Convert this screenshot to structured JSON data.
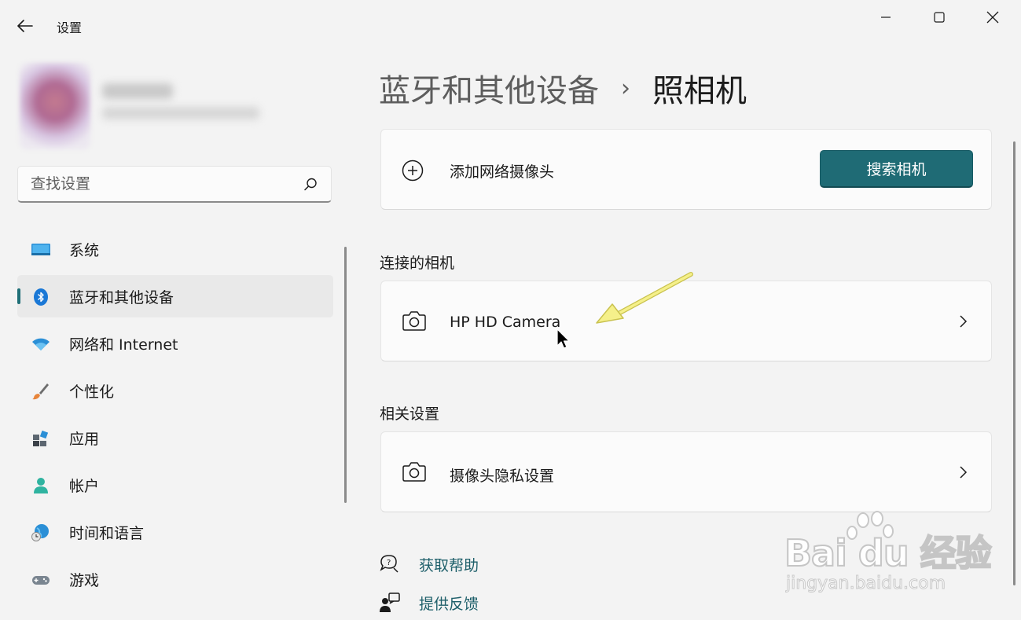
{
  "window": {
    "title": "设置"
  },
  "search": {
    "placeholder": "查找设置"
  },
  "sidebar": {
    "items": [
      {
        "label": "系统",
        "icon": "monitor-icon",
        "active": false
      },
      {
        "label": "蓝牙和其他设备",
        "icon": "bluetooth-icon",
        "active": true
      },
      {
        "label": "网络和 Internet",
        "icon": "wifi-icon",
        "active": false
      },
      {
        "label": "个性化",
        "icon": "brush-icon",
        "active": false
      },
      {
        "label": "应用",
        "icon": "apps-icon",
        "active": false
      },
      {
        "label": "帐户",
        "icon": "account-icon",
        "active": false
      },
      {
        "label": "时间和语言",
        "icon": "globe-clock-icon",
        "active": false
      },
      {
        "label": "游戏",
        "icon": "gamepad-icon",
        "active": false
      }
    ]
  },
  "breadcrumb": {
    "parent": "蓝牙和其他设备",
    "separator": "›",
    "current": "照相机"
  },
  "add_camera": {
    "label": "添加网络摄像头",
    "button_label": "搜索相机"
  },
  "connected": {
    "title": "连接的相机",
    "cameras": [
      {
        "label": "HP HD Camera"
      }
    ]
  },
  "related": {
    "title": "相关设置",
    "items": [
      {
        "label": "摄像头隐私设置"
      }
    ]
  },
  "help": {
    "get_help": "获取帮助",
    "feedback": "提供反馈"
  },
  "watermark": {
    "brand": "Bai du 经验",
    "url": "jingyan.baidu.com"
  },
  "colors": {
    "accent": "#1f6b75",
    "link": "#1e5f6a",
    "background": "#f3f3f3",
    "card": "#fbfbfb"
  }
}
